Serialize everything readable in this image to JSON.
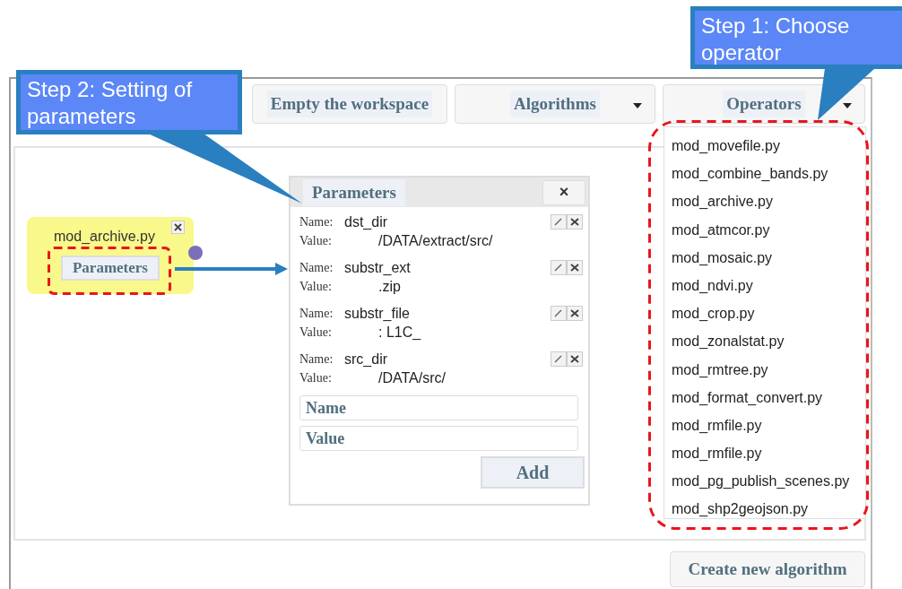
{
  "callouts": [
    {
      "text": "Step 1: Choose operator"
    },
    {
      "text": "Step 2: Setting of parameters"
    }
  ],
  "toolbar": [
    {
      "label": "Empty the workspace",
      "kind": "button"
    },
    {
      "label": "Algorithms",
      "kind": "dropdown"
    },
    {
      "label": "Operators",
      "kind": "dropdown"
    }
  ],
  "operators_menu": [
    "mod_movefile.py",
    "mod_combine_bands.py",
    "mod_archive.py",
    "mod_atmcor.py",
    "mod_mosaic.py",
    "mod_ndvi.py",
    "mod_crop.py",
    "mod_zonalstat.py",
    "mod_rmtree.py",
    "mod_format_convert.py",
    "mod_rmfile.py",
    "mod_rmfile.py",
    "mod_pg_publish_scenes.py",
    "mod_shp2geojson.py"
  ],
  "node": {
    "title": "mod_archive.py",
    "button": "Parameters"
  },
  "parameters_dialog": {
    "title": "Parameters",
    "close": "×",
    "parameters": [
      {
        "name_label": "Name:",
        "name": "dst_dir",
        "value_label": "Value:",
        "value": "/DATA/extract/src/"
      },
      {
        "name_label": "Name:",
        "name": "substr_ext",
        "value_label": "Value:",
        "value": ".zip"
      },
      {
        "name_label": "Name:",
        "name": "substr_file",
        "value_label": "Value:",
        "value": ": L1C_"
      },
      {
        "name_label": "Name:",
        "name": "src_dir",
        "value_label": "Value:",
        "value": "/DATA/src/"
      }
    ],
    "name_field": {
      "placeholder": "Name"
    },
    "value_field": {
      "placeholder": "Value"
    },
    "add_button": "Add"
  },
  "footer_button": "Create new algorithm"
}
